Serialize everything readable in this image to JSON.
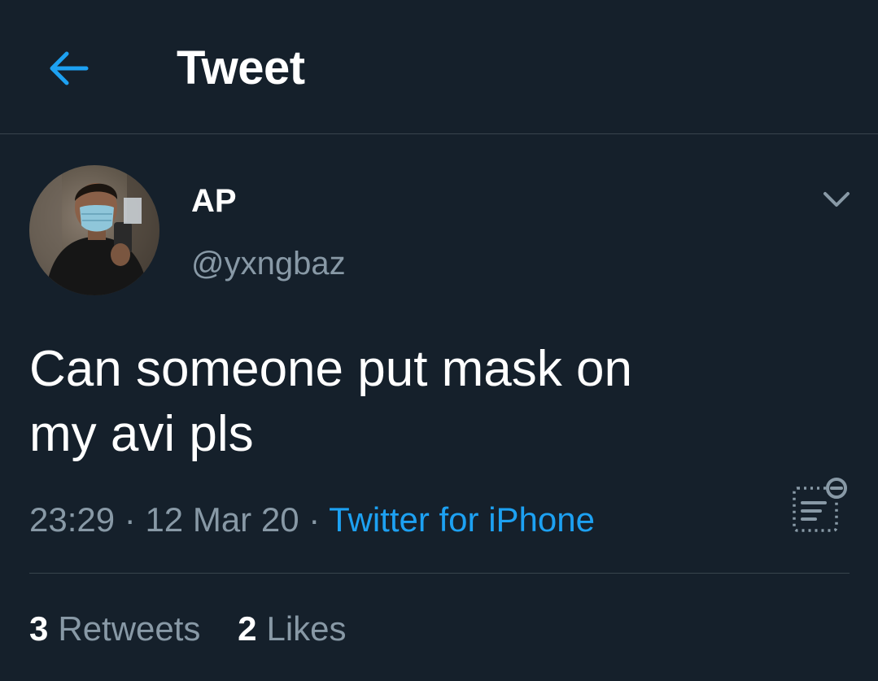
{
  "header": {
    "title": "Tweet",
    "back_icon": "arrow-left-icon"
  },
  "tweet": {
    "author": {
      "name": "AP",
      "handle": "@yxngbaz",
      "avatar": "profile-photo"
    },
    "text": "Can someone put mask on\nmy avi pls",
    "time": "23:29",
    "date": "12 Mar 20",
    "separator": "·",
    "source": "Twitter for iPhone",
    "menu_icon": "chevron-down-icon",
    "analytics_icon": "analytics-icon"
  },
  "stats": {
    "retweets_count": "3",
    "retweets_label": "Retweets",
    "likes_count": "2",
    "likes_label": "Likes"
  },
  "colors": {
    "background": "#15202b",
    "accent": "#1da1f2",
    "secondary_text": "#8899a6",
    "divider": "#38444d"
  }
}
